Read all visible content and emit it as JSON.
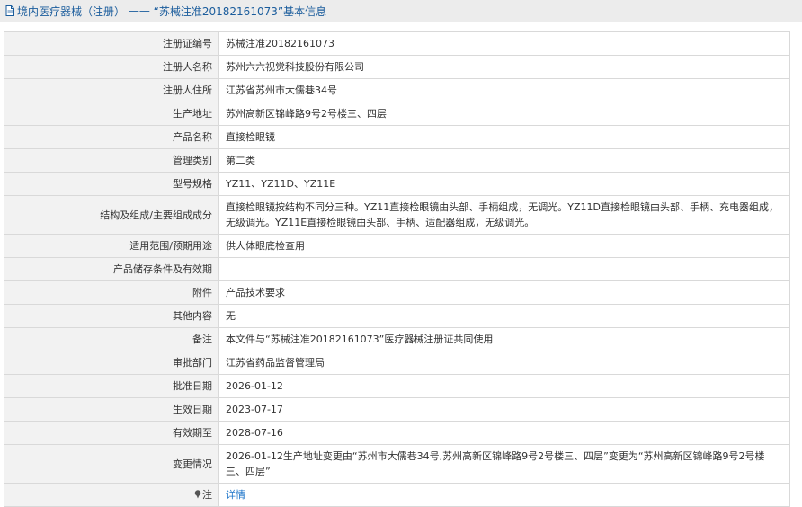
{
  "header": {
    "prefix": "境内医疗器械（注册）",
    "separator": " —— ",
    "title": "“苏械注准20182161073”基本信息"
  },
  "rows": [
    {
      "label": "注册证编号",
      "value": "苏械注准20182161073"
    },
    {
      "label": "注册人名称",
      "value": "苏州六六视觉科技股份有限公司"
    },
    {
      "label": "注册人住所",
      "value": "江苏省苏州市大儒巷34号"
    },
    {
      "label": "生产地址",
      "value": "苏州高新区锦峰路9号2号楼三、四层"
    },
    {
      "label": "产品名称",
      "value": "直接检眼镜"
    },
    {
      "label": "管理类别",
      "value": "第二类"
    },
    {
      "label": "型号规格",
      "value": "YZ11、YZ11D、YZ11E"
    },
    {
      "label": "结构及组成/主要组成成分",
      "value": "直接检眼镜按结构不同分三种。YZ11直接检眼镜由头部、手柄组成，无调光。YZ11D直接检眼镜由头部、手柄、充电器组成，无级调光。YZ11E直接检眼镜由头部、手柄、适配器组成，无级调光。"
    },
    {
      "label": "适用范围/预期用途",
      "value": "供人体眼底检查用"
    },
    {
      "label": "产品储存条件及有效期",
      "value": ""
    },
    {
      "label": "附件",
      "value": "产品技术要求"
    },
    {
      "label": "其他内容",
      "value": "无"
    },
    {
      "label": "备注",
      "value": "本文件与“苏械注准20182161073”医疗器械注册证共同使用"
    },
    {
      "label": "审批部门",
      "value": "江苏省药品监督管理局"
    },
    {
      "label": "批准日期",
      "value": "2026-01-12"
    },
    {
      "label": "生效日期",
      "value": "2023-07-17"
    },
    {
      "label": "有效期至",
      "value": "2028-07-16"
    },
    {
      "label": "变更情况",
      "value": "2026-01-12生产地址变更由“苏州市大儒巷34号,苏州高新区锦峰路9号2号楼三、四层”变更为“苏州高新区锦峰路9号2号楼三、四层”"
    }
  ],
  "note": {
    "label": "注",
    "link": "详情"
  },
  "colors": {
    "accent": "#1a5c9c",
    "link": "#1a73c9",
    "label_bg": "#f2f2f2",
    "border": "#d9d9d9"
  }
}
